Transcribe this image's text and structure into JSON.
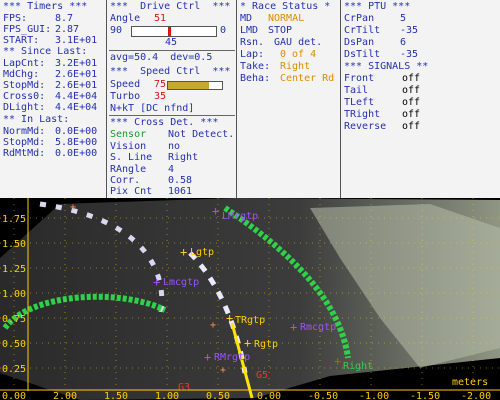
{
  "timers": {
    "header": "*** Timers ***",
    "fps_label": "FPS:",
    "fps": "8.7",
    "fpsgui_label": "FPS_GUI:",
    "fpsgui": "2.87",
    "start_label": "START:",
    "start": "3.1E+01",
    "since_header": "** Since Last:",
    "lapcnt_label": "LapCnt:",
    "lapcnt": "3.2E+01",
    "mdchg_label": "MdChg:",
    "mdchg": "2.6E+01",
    "stopmd_label": "StopMd:",
    "stopmd": "2.6E+01",
    "cross0_label": "Cross0:",
    "cross0": "4.4E+04",
    "dlight_label": "DLight:",
    "dlight": "4.4E+04",
    "in_header": "** In Last:",
    "normmd_label": "NormMd:",
    "normmd": "0.0E+00",
    "stopmd2_label": "StopMd:",
    "stopmd2": "5.8E+00",
    "rdmtmd_label": "RdMtMd:",
    "rdmtmd": "0.0E+00"
  },
  "drive": {
    "header": "***  Drive Ctrl  ***",
    "angle_label": "Angle",
    "angle": "51",
    "slider_min": "90",
    "slider_max": "0",
    "slider_level": 0.45,
    "slider_value": "45",
    "avg_line": "avg=50.4  dev=0.5",
    "speed_header": "***  Speed Ctrl  ***",
    "speed_label": "Speed",
    "speed": "75",
    "speed_level": 0.75,
    "turbo_label": "Turbo",
    "turbo": "35",
    "nkt_line": "N+kT [DC nfnd]",
    "cross_header": "*** Cross Det. ***",
    "sensor_label": "Sensor",
    "sensor": "Not Detect.",
    "vision_label": "Vision",
    "vision": "no",
    "sline_label": "S. Line",
    "sline": "Right",
    "rangle_label": "RAngle",
    "rangle": "4",
    "corr_label": "Corr.",
    "corr": "0.58",
    "pixcnt_label": "Pix Cnt",
    "pixcnt": "1061"
  },
  "race": {
    "header": "* Race Status *",
    "md_label": "MD",
    "md": "NORMAL",
    "lmd_label": "LMD",
    "lmd": "STOP",
    "rsn_label": "Rsn.",
    "rsn": "GAU det.",
    "lap_label": "Lap:",
    "lap": "0 of 4",
    "take_label": "Take:",
    "take": "Right",
    "beha_label": "Beha:",
    "beha": "Center Rd"
  },
  "ptu": {
    "header": "*** PTU ***",
    "crpan_label": "CrPan",
    "crpan": "5",
    "crtilt_label": "CrTilt",
    "crtilt": "-35",
    "dspan_label": "DsPan",
    "dspan": "6",
    "dstilt_label": "DsTilt",
    "dstilt": "-35",
    "signals_header": "*** SIGNALS **",
    "front_label": "Front",
    "front": "off",
    "tail_label": "Tail",
    "tail": "off",
    "tleft_label": "TLeft",
    "tleft": "off",
    "tright_label": "TRight",
    "tright": "off",
    "reverse_label": "Reverse",
    "reverse": "off"
  },
  "view": {
    "y_ticks": [
      "1.75",
      "1.50",
      "1.25",
      "1.00",
      "0.75",
      "0.50",
      "0.25"
    ],
    "x_ticks": [
      "0.00",
      "2.00",
      "1.50",
      "1.00",
      "0.50",
      "0.00",
      "-0.50",
      "-1.00",
      "-1.50",
      "-2.00"
    ],
    "units": "meters",
    "markers": {
      "lmrgtp": "LMrgtp",
      "lgtp": "Lgtp",
      "lmcgtp": "Lmcgtp",
      "trgtp": "TRgtp",
      "rmcgtp": "Rmcgtp",
      "rmrgtp": "RMrgtp",
      "rgtp": "Rgtp",
      "g3": "G3",
      "g5": "G5",
      "right": "Right"
    }
  },
  "colors": {
    "panel_bg": "#f3f3f3",
    "label": "#2430b0",
    "value_red": "#d41818",
    "value_orange": "#e08a00",
    "sensor_green": "#1a9a2a",
    "lane_green": "#2fd04a",
    "axis_yellow": "#ffd000",
    "marker_purple": "#a050ff"
  }
}
